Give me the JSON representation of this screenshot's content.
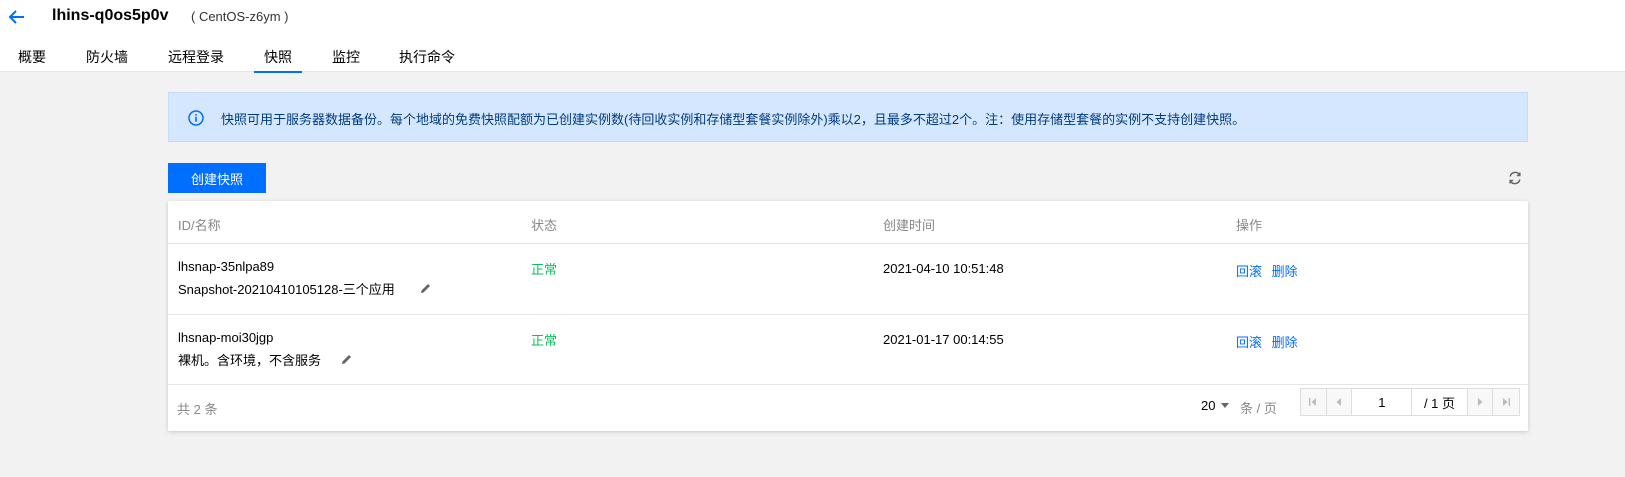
{
  "header": {
    "instance_name": "lhins-q0os5p0v",
    "instance_os": "( CentOS-z6ym )"
  },
  "tabs": [
    {
      "label": "概要"
    },
    {
      "label": "防火墙"
    },
    {
      "label": "远程登录"
    },
    {
      "label": "快照",
      "active": true
    },
    {
      "label": "监控"
    },
    {
      "label": "执行命令"
    }
  ],
  "notice": {
    "text": "快照可用于服务器数据备份。每个地域的免费快照配额为已创建实例数(待回收实例和存储型套餐实例除外)乘以2，且最多不超过2个。注：使用存储型套餐的实例不支持创建快照。"
  },
  "toolbar": {
    "create_label": "创建快照"
  },
  "table": {
    "columns": [
      "ID/名称",
      "状态",
      "创建时间",
      "操作"
    ],
    "rows": [
      {
        "id": "lhsnap-35nlpa89",
        "name": "Snapshot-20210410105128-三个应用",
        "status": "正常",
        "created": "2021-04-10 10:51:48",
        "action_rollback": "回滚",
        "action_delete": "删除"
      },
      {
        "id": "lhsnap-moi30jgp",
        "name": "裸机。含环境，不含服务",
        "status": "正常",
        "created": "2021-01-17 00:14:55",
        "action_rollback": "回滚",
        "action_delete": "删除"
      }
    ]
  },
  "pagination": {
    "total_text": "共 2 条",
    "page_size": "20",
    "page_unit": "条 / 页",
    "current_page": "1",
    "total_pages": "/ 1 页"
  },
  "colors": {
    "primary": "#006eff",
    "success": "#0abf5b",
    "notice_bg": "#d5e7ff"
  }
}
